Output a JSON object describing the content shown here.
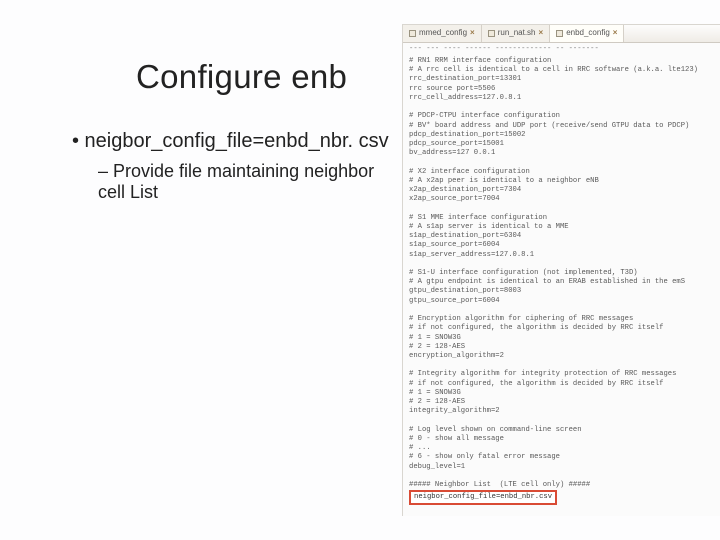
{
  "title": "Configure enb",
  "bullet_main": "• neigbor_config_file=enbd_nbr. csv",
  "bullet_sub": "– Provide file maintaining neighbor cell List",
  "tabs": [
    {
      "label": "mmed_config"
    },
    {
      "label": "run_nat.sh"
    },
    {
      "label": "enbd_config"
    }
  ],
  "topline": "--- --- ----  ------ ------------- -- -------",
  "code": [
    "# RN1 RRM interface configuration",
    "# A rrc cell is identical to a cell in RRC software (a.k.a. lte123)",
    "rrc_destination_port=13301",
    "rrc source port=5506",
    "rrc_cell_address=127.0.8.1",
    "",
    "# PDCP-CTPU interface configuration",
    "# BV* board address and UDP port (receive/send GTPU data to PDCP)",
    "pdcp_destination_port=15002",
    "pdcp_source_port=15001",
    "bv_address=127 0.0.1",
    "",
    "# X2 interface configuration",
    "# A x2ap peer is identical to a neighbor eNB",
    "x2ap_destination_port=7304",
    "x2ap_source_port=7004",
    "",
    "# S1 MME interface configuration",
    "# A s1ap server is identical to a MME",
    "s1ap_destination_port=6304",
    "s1ap_source_port=6004",
    "s1ap_server_address=127.0.8.1",
    "",
    "# S1-U interface configuration (not implemented, T3D)",
    "# A gtpu endpoint is identical to an ERAB established in the emS",
    "gtpu_destination_port=8003",
    "gtpu_source_port=6004",
    "",
    "# Encryption algorithm for ciphering of RRC messages",
    "# if not configured, the algorithm is decided by RRC itself",
    "# 1 = SNOW3G",
    "# 2 = 128-AES",
    "encryption_algorithm=2",
    "",
    "# Integrity algorithm for integrity protection of RRC messages",
    "# if not configured, the algorithm is decided by RRC itself",
    "# 1 = SNOW3G",
    "# 2 = 128-AES",
    "integrity_algorithm=2",
    "",
    "# Log level shown on command-line screen",
    "# 0 - show all message",
    "# ...",
    "# 6 - show only fatal error message",
    "debug_level=1",
    "",
    "##### Neighbor List  (LTE cell only) #####"
  ],
  "highlight_line": "neigbor_config_file=enbd_nbr.csv"
}
